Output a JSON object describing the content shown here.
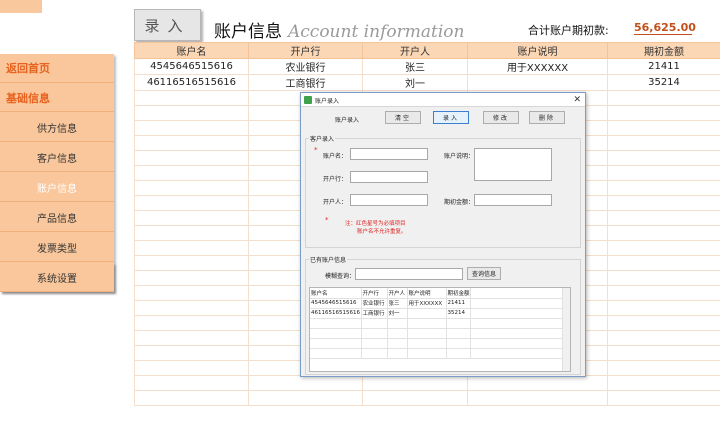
{
  "sidebar": {
    "home": "返回首页",
    "basic": "基础信息",
    "items": [
      {
        "label": "供方信息"
      },
      {
        "label": "客户信息"
      },
      {
        "label": "账户信息"
      },
      {
        "label": "产品信息"
      },
      {
        "label": "发票类型"
      },
      {
        "label": "系统设置"
      }
    ]
  },
  "header": {
    "entry_button": "录入",
    "title_cn": "账户信息",
    "title_en": "Account information",
    "total_label": "合计账户期初款:",
    "total_value": "56,625.00"
  },
  "sheet": {
    "columns": [
      "账户名",
      "开户行",
      "开户人",
      "账户说明",
      "期初金额"
    ],
    "rows": [
      [
        "4545646515616",
        "农业银行",
        "张三",
        "用于XXXXXX",
        "21411"
      ],
      [
        "46116516515616",
        "工商银行",
        "刘一",
        "",
        "35214"
      ]
    ]
  },
  "dialog": {
    "title": "账户录入",
    "section_label": "账户录入",
    "buttons": {
      "enter": "录入",
      "clear": "清空",
      "edit": "修改",
      "delete": "删除"
    },
    "group_entry": "客户录入",
    "fields": {
      "account_name": "账户名：",
      "bank": "开户行：",
      "holder": "开户人：",
      "description": "账户说明：",
      "initial_amount": "期初金额："
    },
    "note_line1": "注：红色星号为必填项目",
    "note_line2": "账户名不允许重复。",
    "group_existing": "已有账户信息",
    "search_label": "模糊查询：",
    "search_button": "查询信息",
    "grid": {
      "columns": [
        "账户名",
        "开户行",
        "开户人",
        "账户说明",
        "期初金额"
      ],
      "rows": [
        [
          "4545646515616",
          "农业银行",
          "张三",
          "用于XXXXXX",
          "21411"
        ],
        [
          "46116516515616",
          "工商银行",
          "刘一",
          "",
          "35214"
        ]
      ]
    }
  },
  "colors": {
    "accent": "#e8611e",
    "sidebar": "#f9c79b",
    "header_fill": "#fbd7b5",
    "total": "#c3501b"
  }
}
